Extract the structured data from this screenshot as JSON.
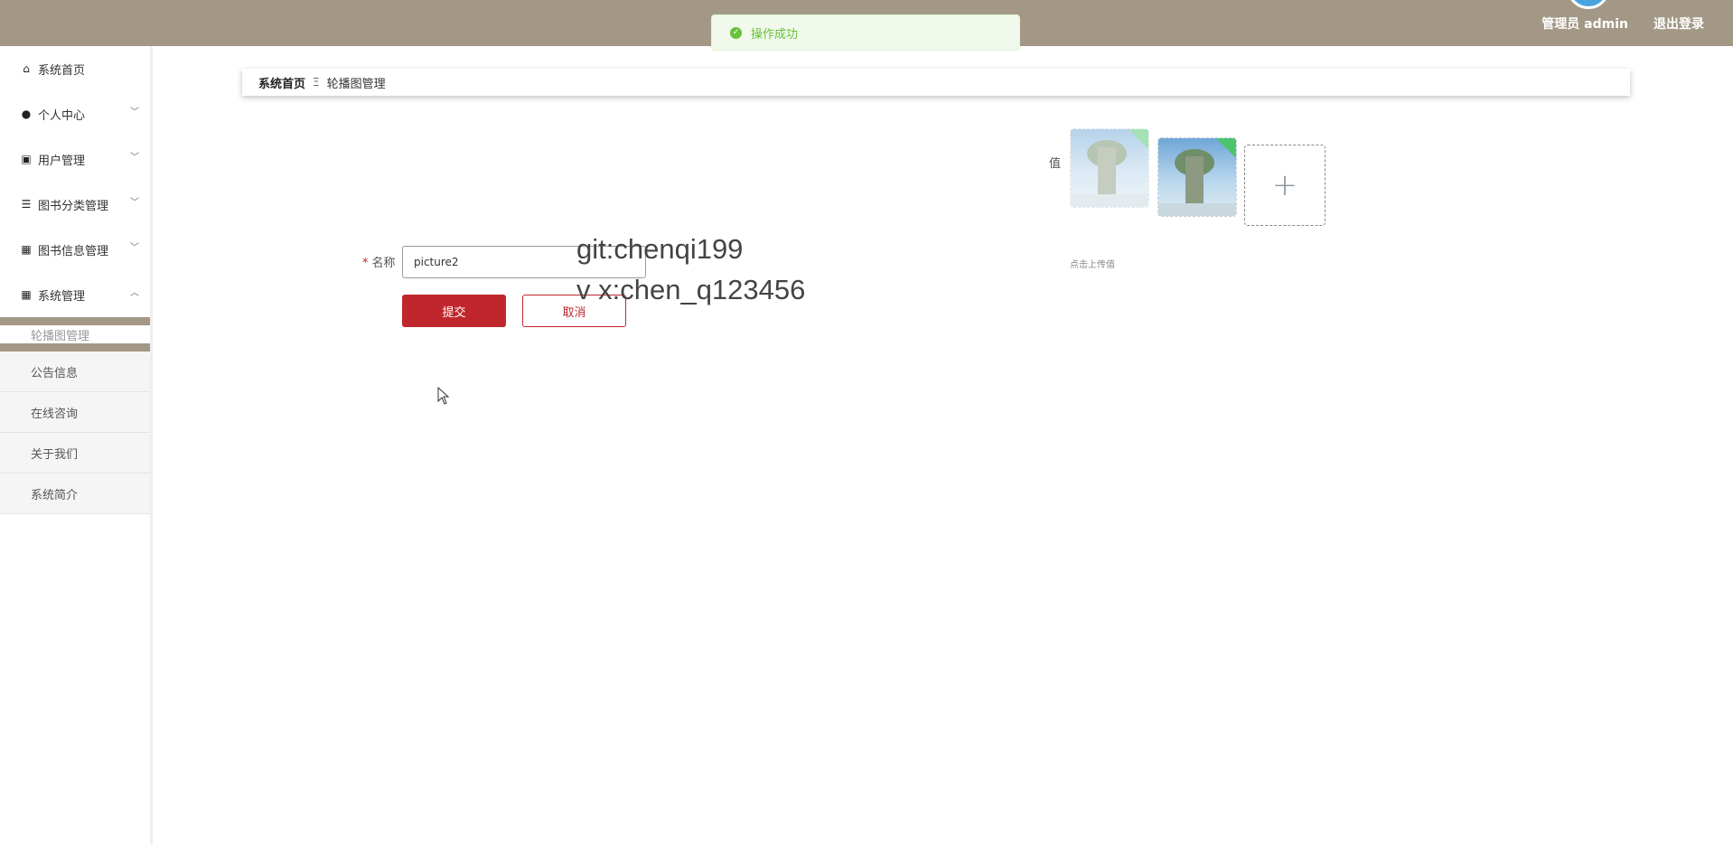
{
  "header": {
    "user_label": "管理员 admin",
    "logout_label": "退出登录"
  },
  "toast": {
    "message": "操作成功",
    "status_color": "#67c23a"
  },
  "sidebar": {
    "items": [
      {
        "label": "系统首页",
        "icon": "home-icon"
      },
      {
        "label": "个人中心",
        "icon": "user-icon"
      },
      {
        "label": "用户管理",
        "icon": "clipboard-icon"
      },
      {
        "label": "图书分类管理",
        "icon": "list-icon"
      },
      {
        "label": "图书信息管理",
        "icon": "grid-icon"
      },
      {
        "label": "系统管理",
        "icon": "grid-icon"
      }
    ],
    "submenu": [
      {
        "label": "轮播图管理",
        "active": true
      },
      {
        "label": "公告信息"
      },
      {
        "label": "在线咨询"
      },
      {
        "label": "关于我们"
      },
      {
        "label": "系统简介"
      }
    ]
  },
  "breadcrumb": {
    "home": "系统首页",
    "separator_icon": "Ξ",
    "current": "轮播图管理"
  },
  "form": {
    "name_label": "名称",
    "required_mark": "*",
    "name_value": "picture2",
    "submit_label": "提交",
    "cancel_label": "取消",
    "value_label": "值",
    "upload_tip": "点击上传值",
    "upload_plus": "+"
  },
  "watermark": {
    "line1": "git:chenqi199",
    "line2": "v x:chen_q123456"
  },
  "colors": {
    "header_bg": "#a39886",
    "primary": "#c0272d"
  }
}
